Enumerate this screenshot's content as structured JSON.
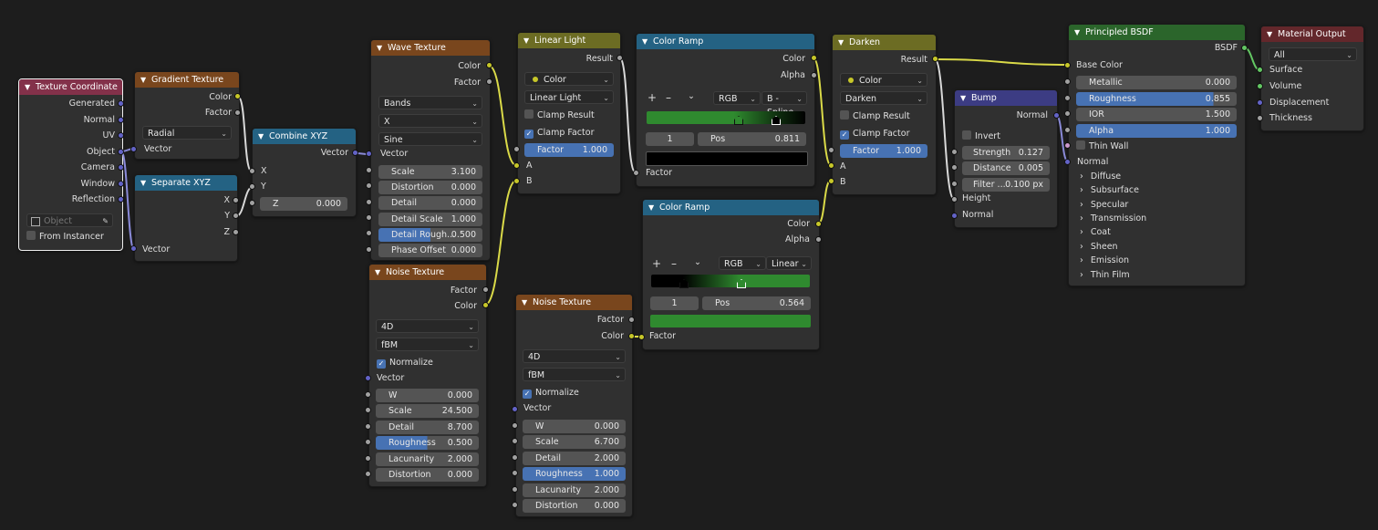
{
  "texcoord": {
    "title": "Texture Coordinate",
    "outputs": [
      "Generated",
      "Normal",
      "UV",
      "Object",
      "Camera",
      "Window",
      "Reflection"
    ],
    "object_placeholder": "Object",
    "from_instancer": "From Instancer"
  },
  "gradient": {
    "title": "Gradient Texture",
    "out_color": "Color",
    "out_factor": "Factor",
    "type": "Radial",
    "in_vector": "Vector"
  },
  "separate": {
    "title": "Separate XYZ",
    "out_x": "X",
    "out_y": "Y",
    "out_z": "Z",
    "in_vector": "Vector"
  },
  "combine": {
    "title": "Combine XYZ",
    "out_vector": "Vector",
    "in_x": "X",
    "in_y": "Y",
    "z_label": "Z",
    "z_value": "0.000"
  },
  "wave": {
    "title": "Wave Texture",
    "out_color": "Color",
    "out_factor": "Factor",
    "type": "Bands",
    "direction": "X",
    "profile": "Sine",
    "in_vector": "Vector",
    "fields": [
      {
        "label": "Scale",
        "value": "3.100"
      },
      {
        "label": "Distortion",
        "value": "0.000"
      },
      {
        "label": "Detail",
        "value": "0.000"
      },
      {
        "label": "Detail Scale",
        "value": "1.000"
      },
      {
        "label": "Detail Rough...",
        "value": "0.500"
      },
      {
        "label": "Phase Offset",
        "value": "0.000"
      }
    ]
  },
  "noise1": {
    "title": "Noise Texture",
    "out_factor": "Factor",
    "out_color": "Color",
    "dim": "4D",
    "type": "fBM",
    "normalize": "Normalize",
    "in_vector": "Vector",
    "fields": [
      {
        "label": "W",
        "value": "0.000"
      },
      {
        "label": "Scale",
        "value": "24.500"
      },
      {
        "label": "Detail",
        "value": "8.700"
      },
      {
        "label": "Roughness",
        "value": "0.500"
      },
      {
        "label": "Lacunarity",
        "value": "2.000"
      },
      {
        "label": "Distortion",
        "value": "0.000"
      }
    ]
  },
  "linear": {
    "title": "Linear Light",
    "out_result": "Result",
    "data_type": "Color",
    "blend": "Linear Light",
    "clamp_result": "Clamp Result",
    "clamp_factor": "Clamp Factor",
    "factor_label": "Factor",
    "factor_value": "1.000",
    "in_a": "A",
    "in_b": "B"
  },
  "noise2": {
    "title": "Noise Texture",
    "out_factor": "Factor",
    "out_color": "Color",
    "dim": "4D",
    "type": "fBM",
    "normalize": "Normalize",
    "in_vector": "Vector",
    "fields": [
      {
        "label": "W",
        "value": "0.000"
      },
      {
        "label": "Scale",
        "value": "6.700"
      },
      {
        "label": "Detail",
        "value": "2.000"
      },
      {
        "label": "Roughness",
        "value": "1.000"
      },
      {
        "label": "Lacunarity",
        "value": "2.000"
      },
      {
        "label": "Distortion",
        "value": "0.000"
      }
    ]
  },
  "ramp1": {
    "title": "Color Ramp",
    "out_color": "Color",
    "out_alpha": "Alpha",
    "plus": "+",
    "minus": "–",
    "chev": "⌄",
    "mode": "RGB",
    "interp": "B - Spline",
    "index": "1",
    "pos_label": "Pos",
    "pos_value": "0.811",
    "in_factor": "Factor"
  },
  "ramp2": {
    "title": "Color Ramp",
    "out_color": "Color",
    "out_alpha": "Alpha",
    "plus": "+",
    "minus": "–",
    "chev": "⌄",
    "mode": "RGB",
    "interp": "Linear",
    "index": "1",
    "pos_label": "Pos",
    "pos_value": "0.564",
    "in_factor": "Factor"
  },
  "darken": {
    "title": "Darken",
    "out_result": "Result",
    "data_type": "Color",
    "blend": "Darken",
    "clamp_result": "Clamp Result",
    "clamp_factor": "Clamp Factor",
    "factor_label": "Factor",
    "factor_value": "1.000",
    "in_a": "A",
    "in_b": "B"
  },
  "bump": {
    "title": "Bump",
    "out_normal": "Normal",
    "invert": "Invert",
    "strength_label": "Strength",
    "strength_value": "0.127",
    "distance_label": "Distance",
    "distance_value": "0.005",
    "filter_label": "Filter ...",
    "filter_value": "0.100 px",
    "in_height": "Height",
    "in_normal": "Normal"
  },
  "bsdf": {
    "title": "Principled BSDF",
    "out_bsdf": "BSDF",
    "base_color": "Base Color",
    "fields": [
      {
        "label": "Metallic",
        "value": "0.000"
      },
      {
        "label": "Roughness",
        "value": "0.855"
      },
      {
        "label": "IOR",
        "value": "1.500"
      },
      {
        "label": "Alpha",
        "value": "1.000"
      }
    ],
    "thin_wall": "Thin Wall",
    "in_normal": "Normal",
    "panels": [
      "Diffuse",
      "Subsurface",
      "Specular",
      "Transmission",
      "Coat",
      "Sheen",
      "Emission",
      "Thin Film"
    ]
  },
  "output": {
    "title": "Material Output",
    "target": "All",
    "in_surface": "Surface",
    "in_volume": "Volume",
    "in_displacement": "Displacement",
    "in_thickness": "Thickness"
  },
  "colors": {
    "yellow": "#c7c729",
    "grey": "#a1a1a1",
    "purple": "#6363c7",
    "green": "#63c763"
  }
}
